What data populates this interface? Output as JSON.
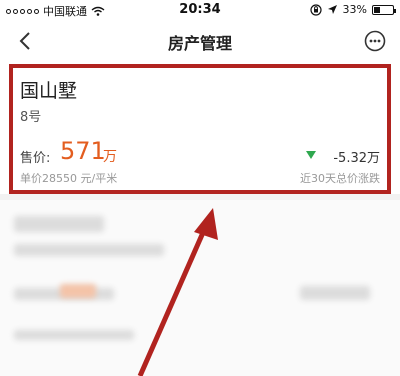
{
  "status_bar": {
    "carrier": "中国联通",
    "time": "20:34",
    "battery": "33%",
    "battery_level": 0.33
  },
  "nav": {
    "title": "房产管理"
  },
  "property": {
    "name": "国山墅",
    "unit": "8号",
    "price_label": "售价:",
    "price_value": "571",
    "price_unit": "万",
    "unit_price": "单价28550 元/平米",
    "change_value": "-5.32万",
    "change_note": "近30天总价涨跌"
  },
  "colors": {
    "highlight_border": "#b1231f",
    "price": "#e35d1f",
    "down_arrow": "#2fa84f"
  },
  "icons": {
    "back": "chevron-left-icon",
    "more": "more-dots-icon",
    "wifi": "wifi-icon",
    "location": "location-arrow-icon",
    "lock": "rotation-lock-icon",
    "battery": "battery-icon"
  }
}
